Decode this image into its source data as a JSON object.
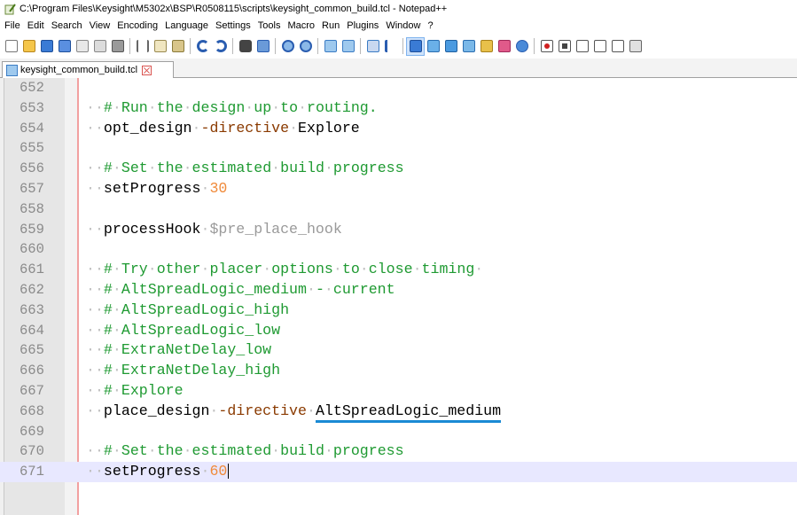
{
  "window": {
    "title": "C:\\Program Files\\Keysight\\M5302x\\BSP\\R0508115\\scripts\\keysight_common_build.tcl - Notepad++"
  },
  "menu": [
    "File",
    "Edit",
    "Search",
    "View",
    "Encoding",
    "Language",
    "Settings",
    "Tools",
    "Macro",
    "Run",
    "Plugins",
    "Window",
    "?"
  ],
  "toolbar": {
    "icons": [
      "new-file-icon",
      "open-file-icon",
      "save-icon",
      "save-all-icon",
      "close-icon",
      "close-all-icon",
      "print-icon",
      "cut-icon",
      "copy-icon",
      "paste-icon",
      "undo-icon",
      "redo-icon",
      "find-icon",
      "replace-icon",
      "zoom-in-icon",
      "zoom-out-icon",
      "sync-vertical-icon",
      "sync-horizontal-icon",
      "word-wrap-icon",
      "show-all-chars-icon",
      "indent-guide-icon",
      "user-language-icon",
      "doc-map-icon",
      "function-list-icon",
      "folder-workspace-icon",
      "monitoring-icon",
      "record-macro-icon",
      "stop-record-icon",
      "playback-macro-icon",
      "run-macro-multiple-icon",
      "save-macro-icon"
    ]
  },
  "tab": {
    "label": "keysight_common_build.tcl"
  },
  "editor": {
    "lines": [
      {
        "no": "652",
        "code": ""
      },
      {
        "no": "653",
        "code": "··#·Run·the·design·up·to·routing."
      },
      {
        "no": "654",
        "code": "··opt_design·-directive·Explore"
      },
      {
        "no": "655",
        "code": ""
      },
      {
        "no": "656",
        "code": "··#·Set·the·estimated·build·progress"
      },
      {
        "no": "657",
        "code": "··setProgress·30"
      },
      {
        "no": "658",
        "code": ""
      },
      {
        "no": "659",
        "code": "··processHook·$pre_place_hook"
      },
      {
        "no": "660",
        "code": ""
      },
      {
        "no": "661",
        "code": "··#·Try·other·placer·options·to·close·timing·"
      },
      {
        "no": "662",
        "code": "··#·AltSpreadLogic_medium·-·current"
      },
      {
        "no": "663",
        "code": "··#·AltSpreadLogic_high"
      },
      {
        "no": "664",
        "code": "··#·AltSpreadLogic_low"
      },
      {
        "no": "665",
        "code": "··#·ExtraNetDelay_low"
      },
      {
        "no": "666",
        "code": "··#·ExtraNetDelay_high"
      },
      {
        "no": "667",
        "code": "··#·Explore"
      },
      {
        "no": "668",
        "code": "··place_design·-directive·AltSpreadLogic_medium"
      },
      {
        "no": "669",
        "code": ""
      },
      {
        "no": "670",
        "code": "··#·Set·the·estimated·build·progress"
      },
      {
        "no": "671",
        "code": "··setProgress·60"
      }
    ],
    "current_line": "671"
  },
  "colors": {
    "comment": "#1f9a32",
    "keyword_option": "#8a3a00",
    "number": "#f08a3a",
    "variable": "#9a9a9a",
    "current_line_bg": "#e8e8ff",
    "underline_highlight": "#1a8ad4"
  }
}
